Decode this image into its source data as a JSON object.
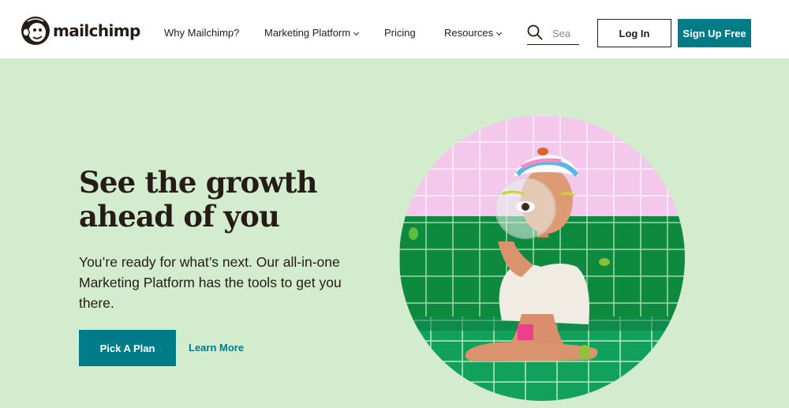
{
  "header": {
    "logo_text": "mailchimp",
    "nav": [
      {
        "label": "Why Mailchimp?"
      },
      {
        "label": "Marketing Platform"
      },
      {
        "label": "Pricing"
      },
      {
        "label": "Resources"
      }
    ],
    "search": {
      "placeholder": "Sea",
      "icon": "search-icon"
    },
    "login_label": "Log In",
    "signup_label": "Sign Up Free"
  },
  "hero": {
    "headline_line1": "See the growth",
    "headline_line2": "ahead of you",
    "subtext": "You’re ready for what’s next. Our all-in-one Marketing Platform has the tools to get you there.",
    "primary_cta": "Pick A Plan",
    "secondary_cta": "Learn More"
  },
  "colors": {
    "background": "#d3ecce",
    "brand_teal": "#007c89",
    "text_dark": "#241c15",
    "header_bg": "#ffffff"
  }
}
